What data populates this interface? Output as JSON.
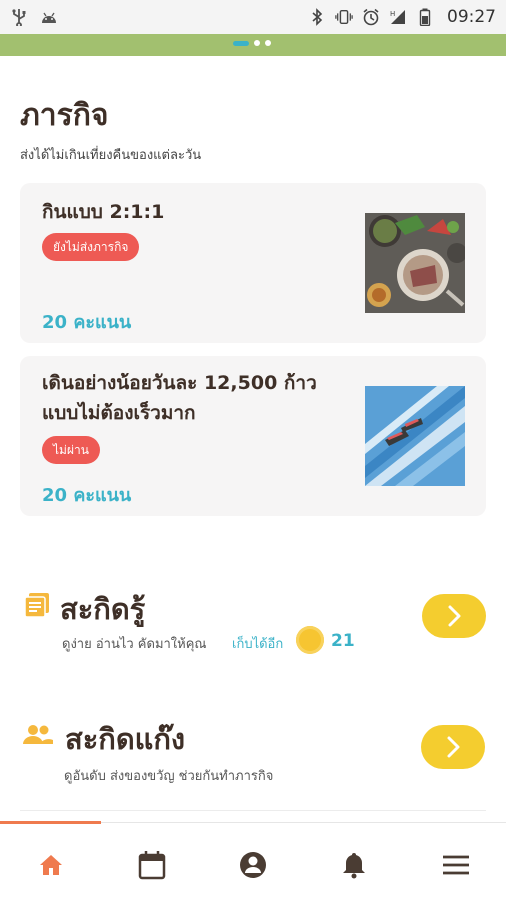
{
  "status_bar": {
    "time": "09:27",
    "left_icons": [
      "usb-icon",
      "android-icon"
    ],
    "right_icons": [
      "bluetooth-icon",
      "vibrate-icon",
      "alarm-icon",
      "signal-icon",
      "battery-icon"
    ]
  },
  "pager": {
    "pages": 3,
    "active": 0
  },
  "missions": {
    "title": "ภารกิจ",
    "subtitle": "ส่งได้ไม่เกินเที่ยงคืนของแต่ละวัน",
    "items": [
      {
        "title": "กินแบบ 2:1:1",
        "status": "ยังไม่ส่งภารกิจ",
        "points": "20 คะแนน",
        "image": "food-plate-photo"
      },
      {
        "title_line1": "เดินอย่างน้อยวันละ 12,500 ก้าว",
        "title_line2": "แบบไม่ต้องเร็วมาก",
        "status": "ไม่ผ่าน",
        "points": "20 คะแนน",
        "image": "walking-stairs-photo"
      }
    ]
  },
  "sakidru": {
    "title": "สะกิดรู้",
    "desc": "ดูง่าย อ่านไว คัดมาให้คุณ",
    "reward_label": "เก็บได้อีก",
    "reward_count": "21",
    "icon": "book-icon"
  },
  "sakidgang": {
    "title": "สะกิดแก๊ง",
    "desc": "ดูอันดับ ส่งของขวัญ ช่วยกันทำภารกิจ",
    "icon": "group-icon"
  },
  "bottom_nav": {
    "items": [
      "home-icon",
      "calendar-icon",
      "profile-icon",
      "bell-icon",
      "menu-icon"
    ],
    "active": "home-icon"
  },
  "colors": {
    "accent_teal": "#3bb2c8",
    "badge_red": "#ee5a54",
    "button_yellow": "#f4cd2f",
    "header_green": "#a2c06f",
    "nav_active": "#ef7a4e"
  }
}
